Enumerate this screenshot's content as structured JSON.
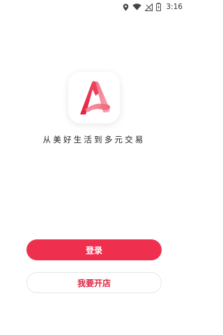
{
  "status_bar": {
    "time": "3:16",
    "icons": [
      "location-icon",
      "wifi-icon",
      "signal-icon",
      "battery-icon"
    ]
  },
  "app": {
    "logo_icon": "app-logo-letter-a",
    "slogan": "从美好生活到多元交易",
    "accent_color": "#ef2f4e"
  },
  "actions": {
    "login_label": "登录",
    "open_store_label": "我要开店"
  }
}
